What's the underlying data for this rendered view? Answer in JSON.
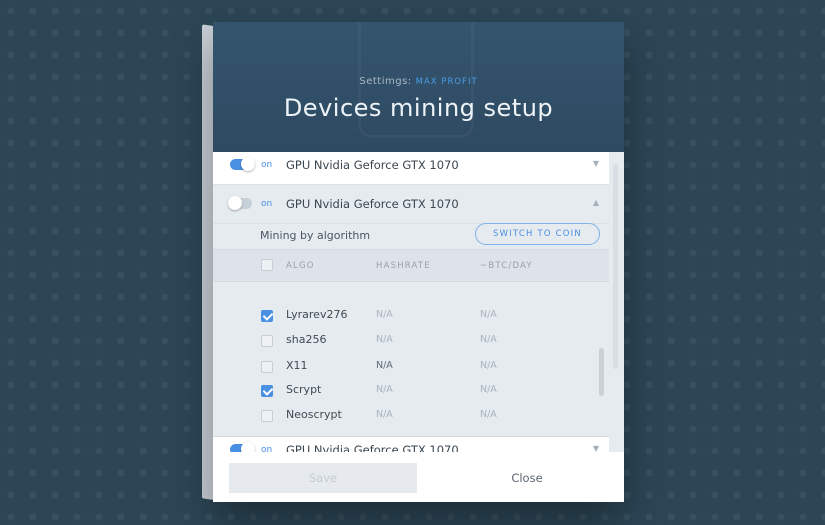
{
  "header": {
    "settings_label": "Settimgs:",
    "settings_value": "MAX PROFIT",
    "title": "Devices mining setup"
  },
  "devices": [
    {
      "toggle_on": true,
      "status": "on",
      "name": "GPU Nvidia Geforce GTX 1070",
      "chevron": "▼"
    },
    {
      "toggle_on": false,
      "status": "on",
      "name": "GPU Nvidia Geforce GTX 1070",
      "chevron": "▲"
    },
    {
      "toggle_on": true,
      "status": "on",
      "name": "GPU Nvidia Geforce GTX 1070",
      "chevron": "▼"
    }
  ],
  "expanded": {
    "mining_label": "Mining by algorithm",
    "switch_button": "SWITCH TO COIN",
    "columns": [
      "ALGO",
      "HASHRATE",
      "~BTC/DAY"
    ],
    "rows": [
      {
        "checked": true,
        "algo": "Lyrarev276",
        "hashrate": "N/A",
        "btc": "N/A"
      },
      {
        "checked": false,
        "algo": "sha256",
        "hashrate": "N/A",
        "btc": "N/A"
      },
      {
        "checked": false,
        "algo": "X11",
        "hashrate": "N/A",
        "btc": "N/A"
      },
      {
        "checked": true,
        "algo": "Scrypt",
        "hashrate": "N/A",
        "btc": "N/A"
      },
      {
        "checked": false,
        "algo": "Neoscrypt",
        "hashrate": "N/A",
        "btc": "N/A"
      }
    ]
  },
  "footer": {
    "save": "Save",
    "close": "Close"
  },
  "colors": {
    "accent": "#4a90e2",
    "header_bg": "#34546e",
    "page_bg": "#2c4656"
  }
}
